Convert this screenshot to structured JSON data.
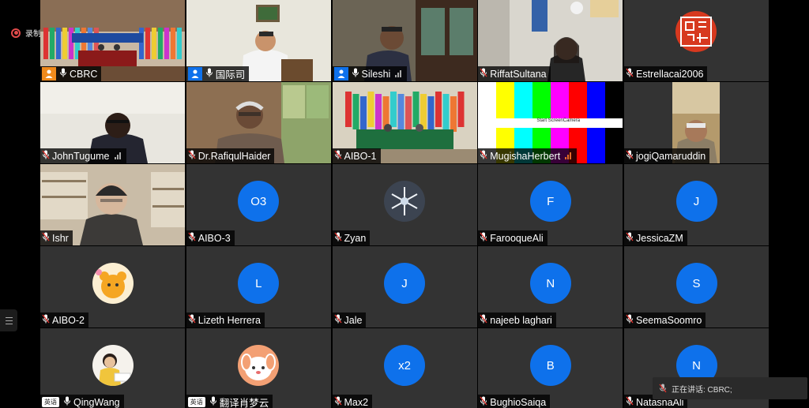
{
  "recording": {
    "label": "录制中"
  },
  "speaking": {
    "label": "正在讲话: CBRC;"
  },
  "participants": [
    {
      "name": "CBRC",
      "kind": "video",
      "scene": "conference-hall",
      "badge": "orange",
      "active": true
    },
    {
      "name": "国际司",
      "kind": "video",
      "scene": "office-man",
      "badge": "blue"
    },
    {
      "name": "Sileshi",
      "kind": "video",
      "scene": "office-suit",
      "badge": "blue",
      "signal": true
    },
    {
      "name": "RiffatSultana",
      "kind": "video",
      "scene": "woman-room"
    },
    {
      "name": "Estrellacai2006",
      "kind": "image",
      "scene": "red-seal"
    },
    {
      "name": "JohnTugume",
      "kind": "video",
      "scene": "man-dark",
      "signal": true
    },
    {
      "name": "Dr.RafiqulHaider",
      "kind": "video",
      "scene": "man-window"
    },
    {
      "name": "AIBO-1",
      "kind": "video",
      "scene": "flags-hall"
    },
    {
      "name": "MugishaHerbert",
      "kind": "video",
      "scene": "color-bars",
      "bars_text": "Start ScreenCamera",
      "signal": true,
      "signal_color": "#e56a2b"
    },
    {
      "name": "jogiQamaruddin",
      "kind": "video",
      "scene": "man-outdoor"
    },
    {
      "name": "Ishr",
      "kind": "video",
      "scene": "man-bookshelf"
    },
    {
      "name": "AIBO-3",
      "kind": "letter",
      "initials": "O3"
    },
    {
      "name": "Zyan",
      "kind": "image",
      "scene": "snowflake"
    },
    {
      "name": "FarooqueAli",
      "kind": "letter",
      "initials": "F"
    },
    {
      "name": "JessicaZM",
      "kind": "letter",
      "initials": "J"
    },
    {
      "name": "AIBO-2",
      "kind": "image",
      "scene": "toy-bear"
    },
    {
      "name": "Lizeth Herrera",
      "kind": "letter",
      "initials": "L"
    },
    {
      "name": "Jale",
      "kind": "letter",
      "initials": "J"
    },
    {
      "name": "najeeb laghari",
      "kind": "letter",
      "initials": "N"
    },
    {
      "name": "SeemaSoomro",
      "kind": "letter",
      "initials": "S"
    },
    {
      "name": "QingWang",
      "kind": "image",
      "scene": "child-study",
      "lang": "英语",
      "mic_white": true
    },
    {
      "name": "翻译肖梦云",
      "kind": "image",
      "scene": "cartoon-dog",
      "lang": "英语",
      "mic_white": true
    },
    {
      "name": "Max2",
      "kind": "letter",
      "initials": "x2"
    },
    {
      "name": "BughioSaiqa",
      "kind": "letter",
      "initials": "B"
    },
    {
      "name": "NatasnaAli",
      "kind": "letter",
      "initials": "N"
    }
  ],
  "colors": {
    "avatar_blue": "#0e71eb",
    "active_border": "#18c25a",
    "tile_bg": "#333333",
    "muted_red": "#e0342f"
  }
}
